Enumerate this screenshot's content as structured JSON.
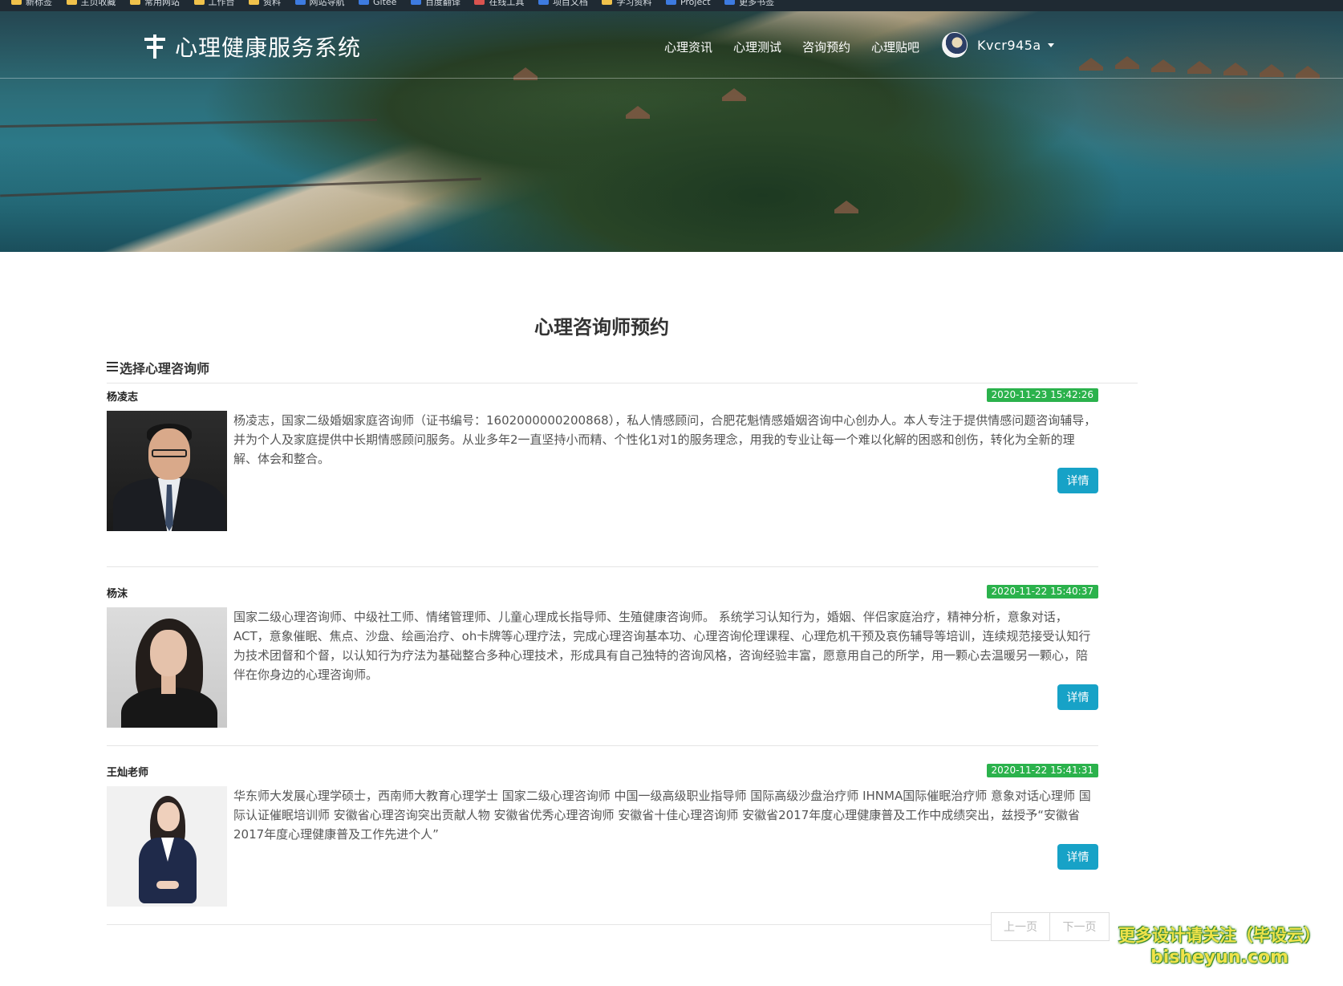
{
  "browser": {
    "bookmarks": [
      "新标签",
      "主页收藏",
      "常用网站",
      "工作台",
      "资料",
      "网站导航",
      "Gitee",
      "百度翻译",
      "在线工具",
      "项目文档",
      "学习资料",
      "Project",
      "更多书签"
    ]
  },
  "navbar": {
    "brand": "心理健康服务系统",
    "links": [
      "心理资讯",
      "心理测试",
      "咨询预约",
      "心理贴吧"
    ],
    "username": "Kvcr945a"
  },
  "main": {
    "title": "心理咨询师预约",
    "section_title": "选择心理咨询师",
    "detail_label": "详情",
    "counselors": [
      {
        "name": "杨凌志",
        "date": "2020-11-23 15:42:26",
        "description": "杨凌志，国家二级婚姻家庭咨询师（证书编号：1602000000200868），私人情感顾问，合肥花魁情感婚姻咨询中心创办人。本人专注于提供情感问题咨询辅导，并为个人及家庭提供中长期情感顾问服务。从业多年2一直坚持小而精、个性化1对1的服务理念，用我的专业让每一个难以化解的困惑和创伤，转化为全新的理解、体会和整合。"
      },
      {
        "name": "杨沫",
        "date": "2020-11-22 15:40:37",
        "description": "国家二级心理咨询师、中级社工师、情绪管理师、儿童心理成长指导师、生殖健康咨询师。 系统学习认知行为，婚姻、伴侣家庭治疗，精神分析，意象对话，ACT，意象催眠、焦点、沙盘、绘画治疗、oh卡牌等心理疗法，完成心理咨询基本功、心理咨询伦理课程、心理危机干预及哀伤辅导等培训，连续规范接受认知行为技术团督和个督，以认知行为疗法为基础整合多种心理技术，形成具有自己独特的咨询风格，咨询经验丰富，愿意用自己的所学，用一颗心去温暖另一颗心，陪伴在你身边的心理咨询师。"
      },
      {
        "name": "王灿老师",
        "date": "2020-11-22 15:41:31",
        "description": "华东师大发展心理学硕士，西南师大教育心理学士 国家二级心理咨询师 中国一级高级职业指导师 国际高级沙盘治疗师 IHNMA国际催眠治疗师 意象对话心理师 国际认证催眠培训师 安徽省心理咨询突出贡献人物 安徽省优秀心理咨询师 安徽省十佳心理咨询师 安徽省2017年度心理健康普及工作中成绩突出，兹授予“安徽省2017年度心理健康普及工作先进个人”"
      }
    ],
    "pager": {
      "prev": "上一页",
      "next": "下一页"
    }
  },
  "watermark": {
    "line1": "更多设计请关注（毕设云）",
    "line2": "bisheyun.com"
  },
  "colors": {
    "date_badge": "#2bb24c",
    "detail_button": "#17a2c7",
    "watermark": "#f0e34a"
  },
  "icons": {
    "brand": "signpost-icon",
    "section": "menu-icon",
    "user_menu": "caret-down-icon"
  }
}
